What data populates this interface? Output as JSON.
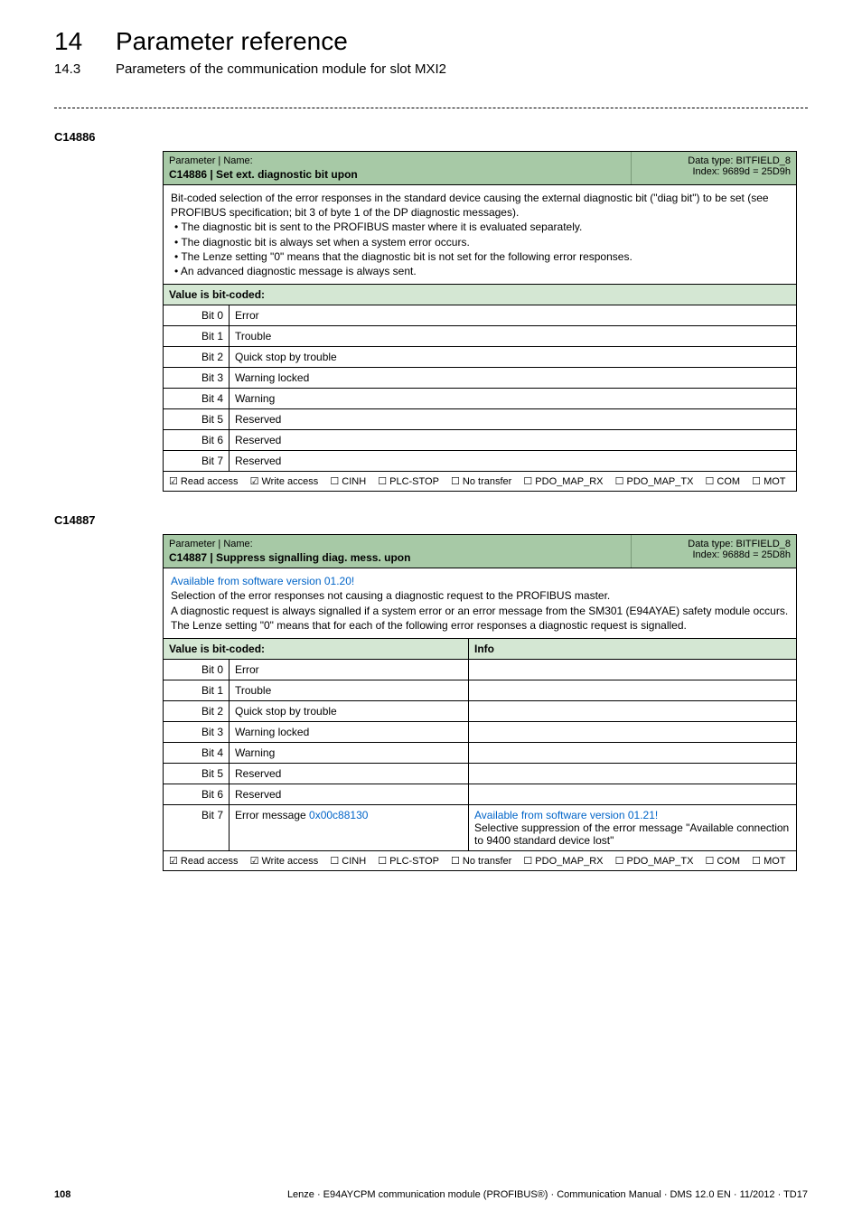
{
  "header": {
    "chapter_num": "14",
    "chapter_title": "Parameter reference",
    "section_num": "14.3",
    "section_title": "Parameters of the communication module for slot MXI2"
  },
  "param1": {
    "id": "C14886",
    "pn_label": "Parameter | Name:",
    "pn_title": "C14886 | Set ext. diagnostic bit upon",
    "datatype_line1": "Data type: BITFIELD_8",
    "datatype_line2": "Index: 9689d = 25D9h",
    "desc_intro": "Bit-coded selection of the error responses in the standard device causing the external diagnostic bit (\"diag bit\") to be set (see PROFIBUS specification; bit 3 of byte 1 of the DP diagnostic messages).",
    "desc_bullets": [
      "The diagnostic bit is sent to the PROFIBUS master where it is evaluated separately.",
      "The diagnostic bit is always set when a system error occurs.",
      "The Lenze setting \"0\" means that the diagnostic bit is not set for the following error responses.",
      "An advanced diagnostic message is always sent."
    ],
    "coded_label": "Value is bit-coded:",
    "bits": [
      {
        "bit": "Bit 0",
        "label": "Error"
      },
      {
        "bit": "Bit 1",
        "label": "Trouble"
      },
      {
        "bit": "Bit 2",
        "label": "Quick stop by trouble"
      },
      {
        "bit": "Bit 3",
        "label": "Warning locked"
      },
      {
        "bit": "Bit 4",
        "label": "Warning"
      },
      {
        "bit": "Bit 5",
        "label": "Reserved"
      },
      {
        "bit": "Bit 6",
        "label": "Reserved"
      },
      {
        "bit": "Bit 7",
        "label": "Reserved"
      }
    ],
    "access": {
      "read": "☑ Read access",
      "write": "☑ Write access",
      "cinh": "☐ CINH",
      "plcstop": "☐ PLC-STOP",
      "notransfer": "☐ No transfer",
      "pdo_rx": "☐ PDO_MAP_RX",
      "pdo_tx": "☐ PDO_MAP_TX",
      "com": "☐ COM",
      "mot": "☐ MOT"
    }
  },
  "param2": {
    "id": "C14887",
    "pn_label": "Parameter | Name:",
    "pn_title": "C14887 | Suppress signalling diag. mess. upon",
    "datatype_line1": "Data type: BITFIELD_8",
    "datatype_line2": "Index: 9688d = 25D8h",
    "desc_avail": "Available from software version 01.20!",
    "desc_lines": [
      "Selection of the error responses not causing a diagnostic request to the PROFIBUS master.",
      "A diagnostic request is always signalled if a system error or an error message from the SM301 (E94AYAE) safety module occurs.",
      "The Lenze setting \"0\" means that for each of the following error responses a diagnostic request is signalled."
    ],
    "coded_label": "Value is bit-coded:",
    "info_label": "Info",
    "bits": [
      {
        "bit": "Bit 0",
        "label": "Error",
        "info_avail": "",
        "info_rest": ""
      },
      {
        "bit": "Bit 1",
        "label": "Trouble",
        "info_avail": "",
        "info_rest": ""
      },
      {
        "bit": "Bit 2",
        "label": "Quick stop by trouble",
        "info_avail": "",
        "info_rest": ""
      },
      {
        "bit": "Bit 3",
        "label": "Warning locked",
        "info_avail": "",
        "info_rest": ""
      },
      {
        "bit": "Bit 4",
        "label": "Warning",
        "info_avail": "",
        "info_rest": ""
      },
      {
        "bit": "Bit 5",
        "label": "Reserved",
        "info_avail": "",
        "info_rest": ""
      },
      {
        "bit": "Bit 6",
        "label": "Reserved",
        "info_avail": "",
        "info_rest": ""
      },
      {
        "bit": "Bit 7",
        "label_pre": "Error message ",
        "label_link": "0x00c88130",
        "info_avail": "Available from software version 01.21!",
        "info_rest": "Selective suppression of the error message \"Available connection to 9400 standard device lost\""
      }
    ],
    "access": {
      "read": "☑ Read access",
      "write": "☑ Write access",
      "cinh": "☐ CINH",
      "plcstop": "☐ PLC-STOP",
      "notransfer": "☐ No transfer",
      "pdo_rx": "☐ PDO_MAP_RX",
      "pdo_tx": "☐ PDO_MAP_TX",
      "com": "☐ COM",
      "mot": "☐ MOT"
    }
  },
  "footer": {
    "page": "108",
    "docline": "Lenze · E94AYCPM communication module (PROFIBUS®) · Communication Manual · DMS 12.0 EN · 11/2012 · TD17"
  }
}
